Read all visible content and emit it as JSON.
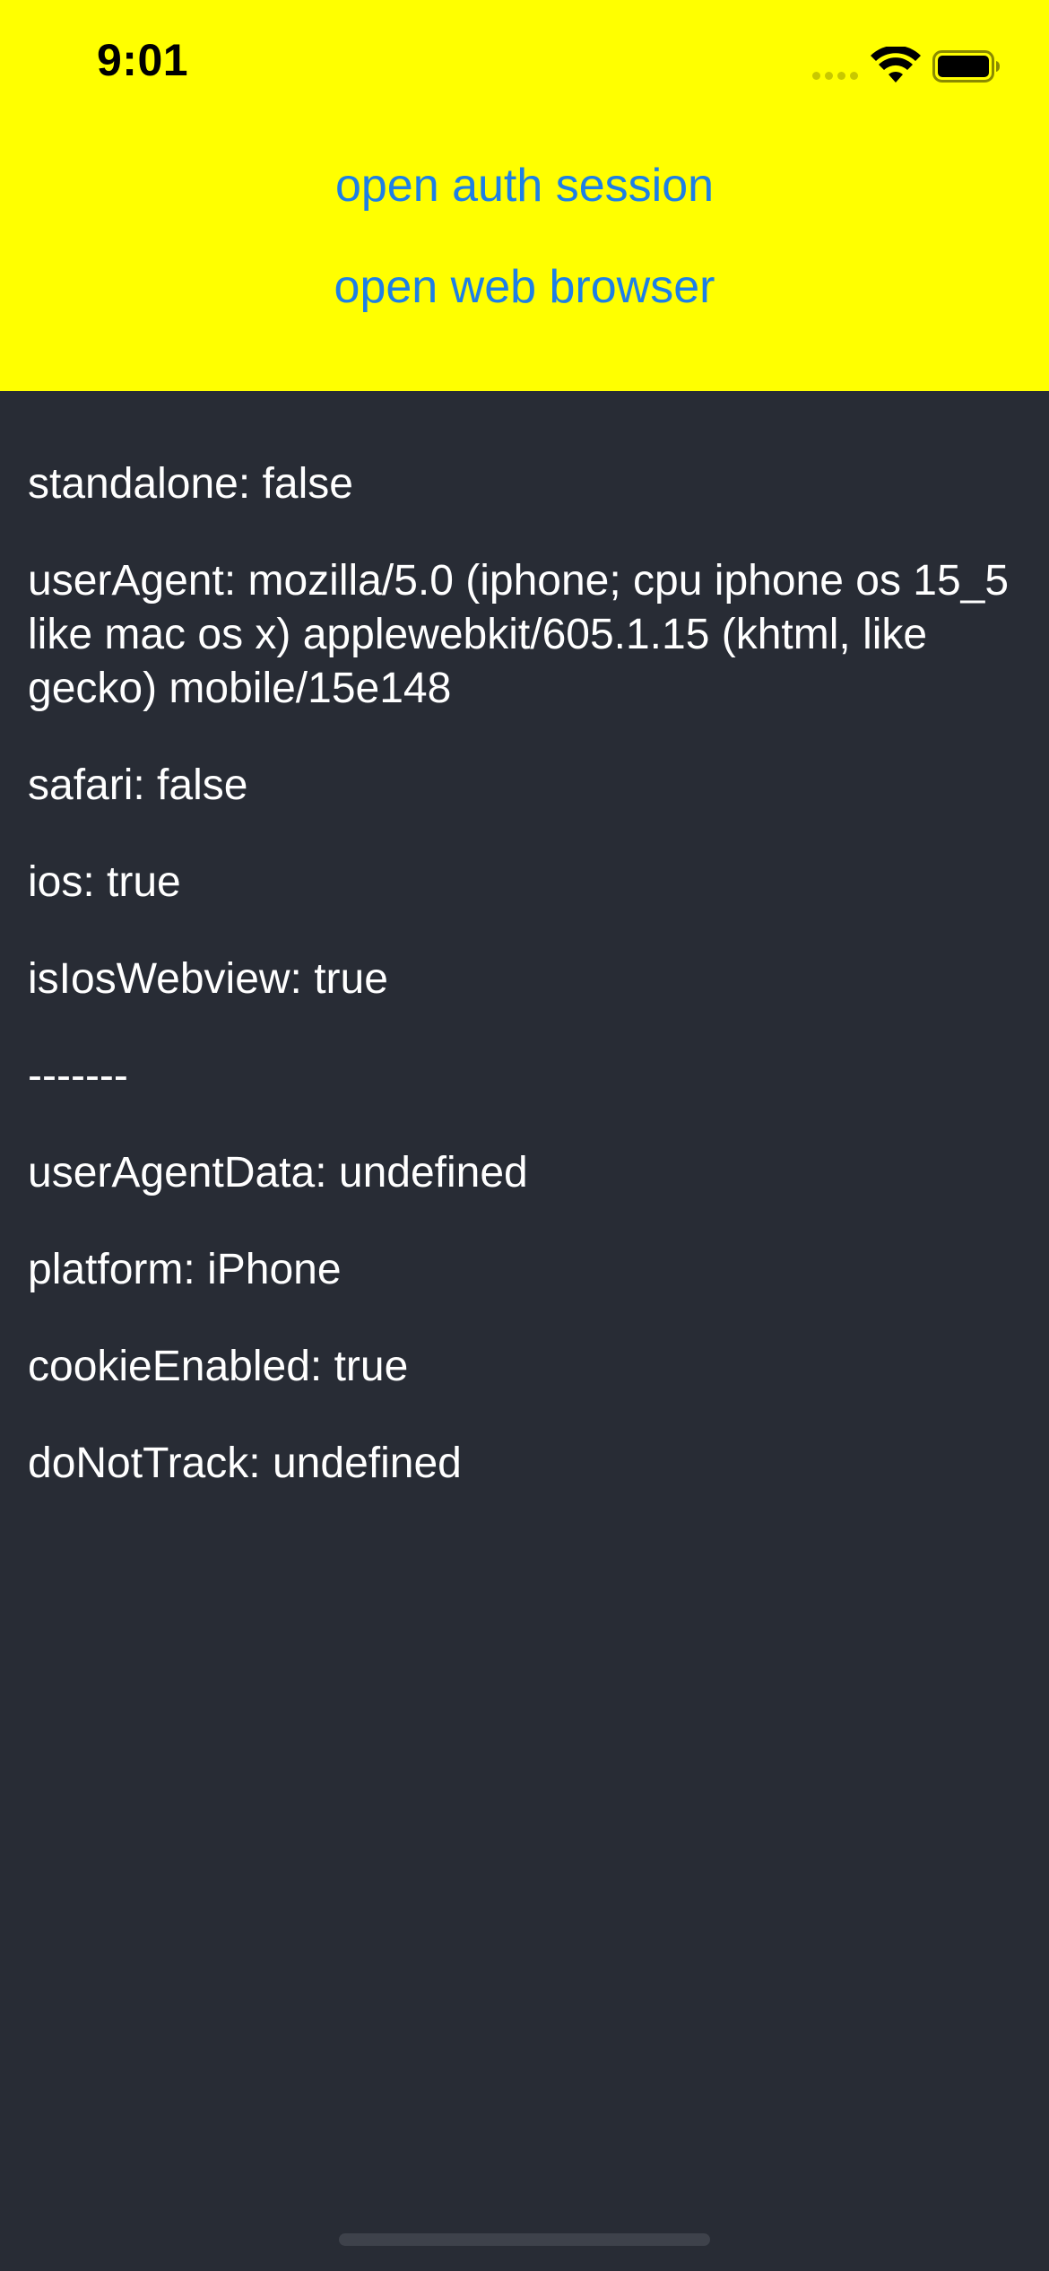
{
  "status_bar": {
    "time": "9:01",
    "icons": [
      "signal-dots-icon",
      "wifi-icon",
      "battery-icon"
    ]
  },
  "buttons": {
    "open_auth_session": "open auth session",
    "open_web_browser": "open web browser"
  },
  "info_lines": [
    "standalone: false",
    "userAgent: mozilla/5.0 (iphone; cpu iphone os 15_5 like mac os x) applewebkit/605.1.15 (khtml, like gecko) mobile/15e148",
    "safari: false",
    "ios: true",
    "isIosWebview: true",
    "-------",
    "userAgentData: undefined",
    "platform: iPhone",
    "cookieEnabled: true",
    "doNotTrack: undefined"
  ],
  "colors": {
    "header_background": "#ffff00",
    "body_background": "#282c35",
    "link": "#1d7fe6",
    "text": "#ffffff"
  }
}
